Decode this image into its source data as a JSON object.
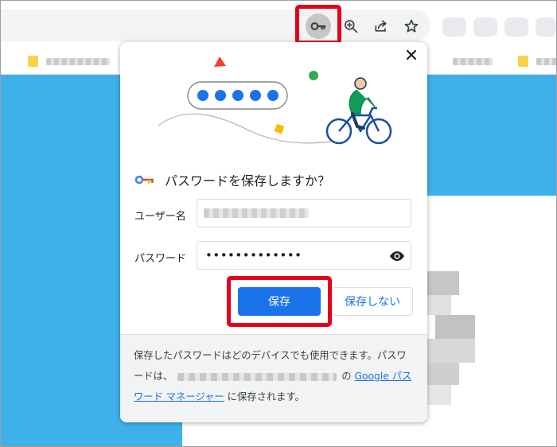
{
  "toolbar": {
    "password_key_icon": "key-icon",
    "zoom_icon": "zoom-in-icon",
    "share_icon": "share-icon",
    "bookmark_icon": "star-icon"
  },
  "dialog": {
    "close_icon": "close-icon",
    "title": "パスワードを保存しますか？",
    "username_label": "ユーザー名",
    "password_label": "パスワード",
    "password_value": "•••••••••••••",
    "show_password_icon": "eye-icon",
    "save_label": "保存",
    "no_save_label": "保存しない",
    "footer_text_1": "保存したパスワードはどのデバイスでも使用できます。パスワードは、",
    "footer_text_2": "の",
    "footer_link": "Google パスワード マネージャー",
    "footer_text_3": "に保存されます。"
  },
  "colors": {
    "accent": "#1a73e8",
    "highlight": "#e4001b",
    "page_blue": "#3eb1ea"
  }
}
